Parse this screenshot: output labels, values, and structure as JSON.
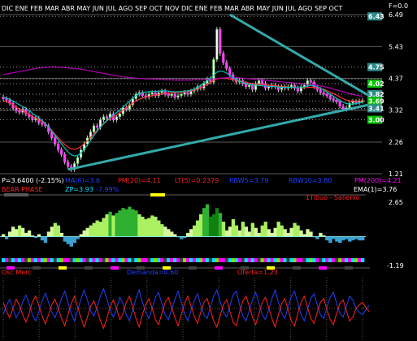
{
  "corner_label": "F=0.0",
  "months_top": "DIC ENE   FEB MAR ABR MAY JUN JUL   AGO SEP OCT NOV DIC ENE   FEB MAR ABR MAY JUN JUL   AGO SEP OCT",
  "chart_data": [
    {
      "type": "candlestick",
      "name": "price-panel",
      "y_ticks": [
        "6.49",
        "5.43",
        "4.37",
        "3.32",
        "2.26",
        "1.21"
      ],
      "ylim": [
        1.21,
        6.49
      ],
      "grid": true,
      "price_tags": [
        {
          "text": "6.43",
          "value": 6.43,
          "color": "#2e8b8b"
        },
        {
          "text": "4.75",
          "value": 4.75,
          "color": "#2e8b8b"
        },
        {
          "text": "4.02",
          "value": 4.2,
          "color": "#00c000"
        },
        {
          "text": "3.82",
          "value": 3.85,
          "color": "#2e8b8b"
        },
        {
          "text": "3.69",
          "value": 3.62,
          "color": "#00c000"
        },
        {
          "text": "3.41",
          "value": 3.38,
          "color": "#2e8b8b"
        },
        {
          "text": "3.00",
          "value": 3.0,
          "color": "#00c000"
        }
      ],
      "close": [
        3.7,
        3.65,
        3.55,
        3.4,
        3.3,
        3.25,
        3.35,
        3.2,
        3.1,
        3.0,
        3.05,
        2.9,
        2.85,
        2.8,
        2.6,
        2.4,
        2.2,
        2.0,
        1.85,
        1.6,
        1.45,
        1.35,
        1.55,
        1.75,
        2.0,
        2.2,
        2.4,
        2.6,
        2.8,
        2.75,
        3.0,
        3.1,
        3.05,
        3.2,
        3.0,
        3.1,
        3.2,
        3.4,
        3.35,
        3.5,
        3.7,
        3.85,
        3.9,
        3.8,
        3.75,
        3.85,
        3.9,
        3.8,
        3.9,
        3.95,
        3.85,
        3.8,
        3.85,
        3.75,
        3.8,
        3.85,
        3.9,
        3.85,
        3.95,
        4.0,
        4.1,
        4.05,
        4.2,
        4.35,
        4.25,
        5.0,
        6.0,
        5.2,
        4.9,
        4.7,
        4.5,
        4.35,
        4.25,
        4.3,
        4.2,
        4.1,
        4.15,
        4.0,
        4.2,
        4.3,
        4.2,
        4.05,
        4.1,
        4.15,
        4.1,
        4.0,
        4.1,
        4.05,
        4.1,
        4.15,
        4.05,
        3.95,
        4.1,
        4.15,
        4.3,
        4.25,
        4.1,
        4.0,
        3.9,
        3.85,
        3.8,
        3.7,
        3.65,
        3.6,
        3.45,
        3.35,
        3.4,
        3.55,
        3.6,
        3.58,
        3.62,
        3.64
      ],
      "lines": [
        {
          "name": "ma-short",
          "color": "#ff3030",
          "values": [
            3.62,
            3.6,
            3.55,
            3.5,
            3.42,
            3.36,
            3.3,
            3.24,
            3.18,
            3.12,
            3.06,
            3.0,
            2.94,
            2.86,
            2.76,
            2.65,
            2.52,
            2.4,
            2.28,
            2.18,
            2.1,
            2.04,
            2.02,
            2.05,
            2.12,
            2.2,
            2.3,
            2.42,
            2.54,
            2.65,
            2.76,
            2.86,
            2.96,
            3.04,
            3.1,
            3.16,
            3.24,
            3.32,
            3.4,
            3.48,
            3.56,
            3.62,
            3.68,
            3.72,
            3.75,
            3.78,
            3.8,
            3.82,
            3.84,
            3.86,
            3.87,
            3.88,
            3.89,
            3.9,
            3.91,
            3.92,
            3.93,
            3.94,
            3.96,
            3.98,
            4.02,
            4.06,
            4.12,
            4.18,
            4.24,
            4.3,
            4.36,
            4.38,
            4.38,
            4.37,
            4.35,
            4.33,
            4.3,
            4.28,
            4.26,
            4.24,
            4.22,
            4.2,
            4.19,
            4.18,
            4.17,
            4.16,
            4.15,
            4.14,
            4.13,
            4.12,
            4.11,
            4.1,
            4.09,
            4.08,
            4.07,
            4.06,
            4.06,
            4.06,
            4.07,
            4.08,
            4.08,
            4.06,
            4.04,
            4.01,
            3.97,
            3.92,
            3.87,
            3.82,
            3.76,
            3.7,
            3.66,
            3.63,
            3.62,
            3.62,
            3.62,
            3.63
          ]
        },
        {
          "name": "ma-long",
          "color": "#b000b0",
          "values": [
            4.5,
            4.52,
            4.54,
            4.56,
            4.58,
            4.6,
            4.62,
            4.64,
            4.66,
            4.68,
            4.7,
            4.72,
            4.73,
            4.74,
            4.75,
            4.76,
            4.76,
            4.75,
            4.74,
            4.73,
            4.72,
            4.71,
            4.7,
            4.69,
            4.68,
            4.66,
            4.64,
            4.62,
            4.6,
            4.58,
            4.56,
            4.54,
            4.52,
            4.5,
            4.48,
            4.46,
            4.44,
            4.42,
            4.41,
            4.4,
            4.39,
            4.38,
            4.37,
            4.37,
            4.36,
            4.36,
            4.35,
            4.35,
            4.34,
            4.34,
            4.33,
            4.33,
            4.33,
            4.32,
            4.32,
            4.32,
            4.32,
            4.32,
            4.32,
            4.33,
            4.33,
            4.33,
            4.34,
            4.34,
            4.35,
            4.36,
            4.37,
            4.38,
            4.39,
            4.4,
            4.4,
            4.4,
            4.4,
            4.39,
            4.38,
            4.37,
            4.36,
            4.35,
            4.34,
            4.33,
            4.32,
            4.31,
            4.3,
            4.29,
            4.28,
            4.27,
            4.26,
            4.25,
            4.24,
            4.23,
            4.22,
            4.21,
            4.2,
            4.19,
            4.18,
            4.17,
            4.16,
            4.14,
            4.12,
            4.1,
            4.08,
            4.05,
            4.02,
            3.99,
            3.96,
            3.93,
            3.9,
            3.87,
            3.84,
            3.82,
            3.8,
            3.78
          ]
        },
        {
          "name": "ma-mid",
          "color": "#00c0c0",
          "values": [
            3.75,
            3.72,
            3.68,
            3.62,
            3.56,
            3.5,
            3.44,
            3.38,
            3.3,
            3.22,
            3.14,
            3.06,
            2.98,
            2.88,
            2.76,
            2.62,
            2.48,
            2.34,
            2.2,
            2.06,
            1.94,
            1.84,
            1.8,
            1.82,
            1.9,
            2.02,
            2.16,
            2.32,
            2.48,
            2.62,
            2.76,
            2.88,
            2.98,
            3.08,
            3.16,
            3.24,
            3.32,
            3.42,
            3.52,
            3.62,
            3.72,
            3.8,
            3.86,
            3.9,
            3.92,
            3.93,
            3.94,
            3.94,
            3.95,
            3.96,
            3.96,
            3.95,
            3.94,
            3.93,
            3.93,
            3.94,
            3.95,
            3.96,
            3.98,
            4.02,
            4.08,
            4.14,
            4.22,
            4.3,
            4.38,
            4.48,
            4.58,
            4.62,
            4.6,
            4.55,
            4.48,
            4.4,
            4.34,
            4.28,
            4.24,
            4.2,
            4.18,
            4.16,
            4.15,
            4.14,
            4.13,
            4.12,
            4.11,
            4.1,
            4.1,
            4.09,
            4.08,
            4.08,
            4.08,
            4.08,
            4.07,
            4.06,
            4.07,
            4.09,
            4.12,
            4.14,
            4.13,
            4.1,
            4.05,
            3.99,
            3.92,
            3.85,
            3.78,
            3.71,
            3.64,
            3.58,
            3.54,
            3.52,
            3.52,
            3.54,
            3.56,
            3.58
          ]
        }
      ],
      "trendlines": [
        {
          "name": "resistance",
          "from": [
            70,
            6.49
          ],
          "to": [
            113,
            3.8
          ],
          "color": "#33a9a9"
        },
        {
          "name": "support",
          "from": [
            20,
            1.35
          ],
          "to": [
            113,
            3.5
          ],
          "color": "#33a9a9"
        }
      ]
    },
    {
      "type": "area",
      "name": "oscillator-panel",
      "y_ticks": [
        "2.65",
        "-1.19"
      ],
      "ylim": [
        -1.6,
        2.9
      ],
      "values": [
        0.2,
        -0.2,
        0.4,
        0.8,
        0.6,
        0.9,
        0.7,
        0.3,
        0.5,
        0.1,
        -0.1,
        0.2,
        -0.3,
        -0.5,
        0.4,
        0.8,
        1.1,
        0.9,
        0.3,
        -0.4,
        -0.6,
        -0.8,
        -0.5,
        -0.2,
        0.2,
        0.5,
        0.7,
        0.9,
        1.1,
        1.3,
        1.2,
        1.5,
        1.8,
        2.0,
        1.7,
        1.9,
        2.1,
        2.3,
        2.2,
        2.4,
        2.2,
        2.1,
        1.8,
        1.6,
        1.4,
        1.5,
        1.7,
        1.6,
        1.3,
        1.0,
        0.8,
        0.6,
        0.4,
        0.2,
        0.0,
        -0.2,
        -0.1,
        0.3,
        0.6,
        0.9,
        1.3,
        1.8,
        2.3,
        2.6,
        1.6,
        1.8,
        2.3,
        1.9,
        1.2,
        0.5,
        0.8,
        1.4,
        0.9,
        0.5,
        1.2,
        0.8,
        0.4,
        1.1,
        0.7,
        0.3,
        0.9,
        1.2,
        0.6,
        0.3,
        0.7,
        1.2,
        0.9,
        0.6,
        0.3,
        0.7,
        1.1,
        0.9,
        0.5,
        0.2,
        0.6,
        0.4,
        0.0,
        -0.2,
        0.3,
        0.1,
        -0.3,
        -0.5,
        -0.2,
        -0.4,
        -0.5,
        -0.3,
        -0.2,
        -0.4,
        -0.3,
        -0.2,
        -0.3,
        -0.3
      ]
    },
    {
      "type": "line",
      "name": "bottom-oscillators",
      "series": [
        {
          "name": "Demanda",
          "color": "#2040ff",
          "values": [
            40,
            55,
            65,
            50,
            35,
            45,
            60,
            72,
            58,
            40,
            30,
            45,
            62,
            75,
            60,
            44,
            35,
            50,
            66,
            78,
            60,
            42,
            30,
            48,
            65,
            80,
            64,
            46,
            38,
            52,
            70,
            82,
            66,
            48,
            36,
            50,
            68,
            58,
            40,
            30,
            48,
            66,
            80,
            60,
            44,
            34,
            50,
            68,
            76,
            58,
            40,
            32,
            48,
            64,
            78,
            60,
            42,
            30,
            46,
            62,
            74,
            56,
            40,
            34,
            52,
            70,
            80,
            62,
            44,
            36,
            54,
            72,
            78,
            56,
            38,
            30,
            46,
            64,
            76,
            58,
            40,
            32,
            48,
            66,
            80,
            60,
            42,
            34,
            52,
            70,
            78,
            58,
            40,
            30,
            48,
            66,
            74,
            56,
            40,
            34,
            52,
            68,
            76,
            58,
            42,
            36,
            54,
            70,
            64,
            50,
            44,
            40,
            48,
            55
          ]
        },
        {
          "name": "Oferta",
          "color": "#ff2020",
          "values": [
            60,
            45,
            35,
            50,
            65,
            55,
            40,
            28,
            42,
            60,
            70,
            55,
            38,
            25,
            40,
            56,
            65,
            50,
            34,
            22,
            40,
            58,
            70,
            52,
            35,
            20,
            36,
            54,
            62,
            48,
            30,
            18,
            34,
            52,
            64,
            50,
            32,
            42,
            60,
            70,
            52,
            34,
            20,
            40,
            56,
            66,
            50,
            32,
            24,
            42,
            60,
            68,
            52,
            36,
            22,
            40,
            58,
            70,
            54,
            38,
            26,
            44,
            60,
            66,
            48,
            30,
            20,
            38,
            56,
            64,
            46,
            28,
            22,
            44,
            62,
            70,
            54,
            36,
            24,
            42,
            60,
            68,
            52,
            34,
            20,
            40,
            58,
            66,
            48,
            30,
            22,
            42,
            60,
            70,
            52,
            34,
            26,
            44,
            60,
            66,
            48,
            32,
            24,
            42,
            58,
            64,
            46,
            30,
            36,
            50,
            56,
            60,
            52,
            45
          ]
        }
      ]
    }
  ],
  "indicators": {
    "row1": [
      {
        "text": "P=3.6400 (-2.15%)",
        "color": "#ffffff"
      },
      {
        "text": "MA(6)=3.6",
        "color": "#2040ff"
      },
      {
        "text": "PM(20)=4.11",
        "color": "#ff2020"
      },
      {
        "text": "LT(5)=0.2379",
        "color": "#ff2020"
      },
      {
        "text": "RBW5=3.79",
        "color": "#2040ff"
      },
      {
        "text": "RBW10=3.80",
        "color": "#2040ff"
      },
      {
        "text": "PM(200)=4.21",
        "color": "#ff00ff"
      }
    ],
    "row2": [
      {
        "text": "BEAR PHASE",
        "color": "#ff2020"
      },
      {
        "text": "ZP=3.93",
        "color": "#00e0ff"
      },
      {
        "text": "-7.99%",
        "color": "#2040ff"
      },
      {
        "text": "EMA(1)=3.76",
        "color": "#ffffff"
      }
    ]
  },
  "osc_label": "1Tibuo - Salienio",
  "bottom_labels": {
    "left": "Osc Merc",
    "demanda": "Demanda=0.60",
    "oferta": "Oferta=1.23"
  }
}
